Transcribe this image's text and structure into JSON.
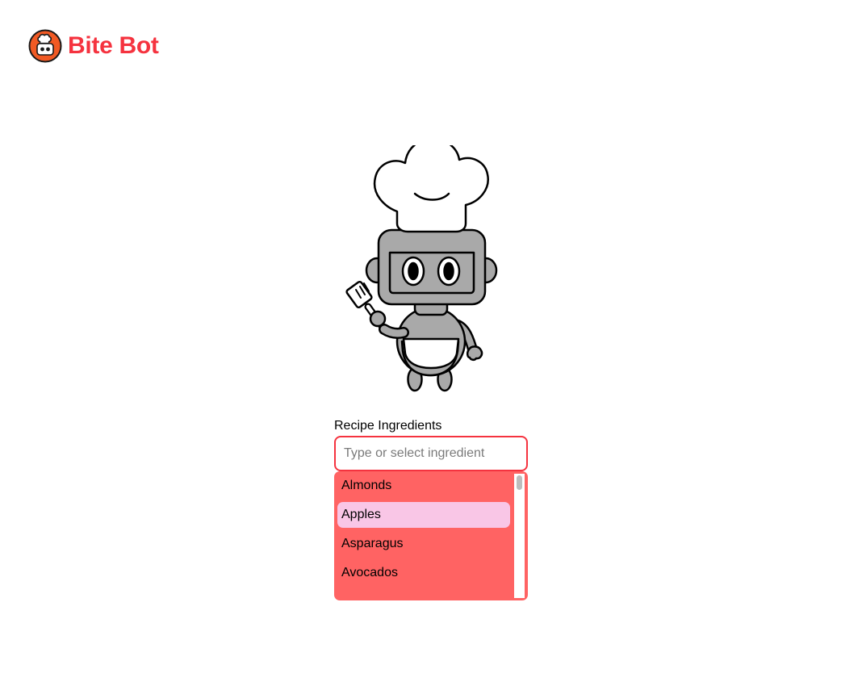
{
  "colors": {
    "brand": "#f5333f",
    "logo_bg": "#f15a24",
    "dropdown_bg": "#ff6363",
    "highlight": "#f9c6e6",
    "robot_gray": "#a9a9a9"
  },
  "header": {
    "brand_name": "Bite Bot",
    "logo_icon": "chef-robot-icon"
  },
  "mascot": {
    "icon": "chef-robot-holding-spatula"
  },
  "ingredients": {
    "label": "Recipe Ingredients",
    "input_value": "",
    "placeholder": "Type or select ingredient",
    "options": [
      {
        "label": "Almonds",
        "highlighted": false
      },
      {
        "label": "Apples",
        "highlighted": true
      },
      {
        "label": "Asparagus",
        "highlighted": false
      },
      {
        "label": "Avocados",
        "highlighted": false
      }
    ]
  }
}
